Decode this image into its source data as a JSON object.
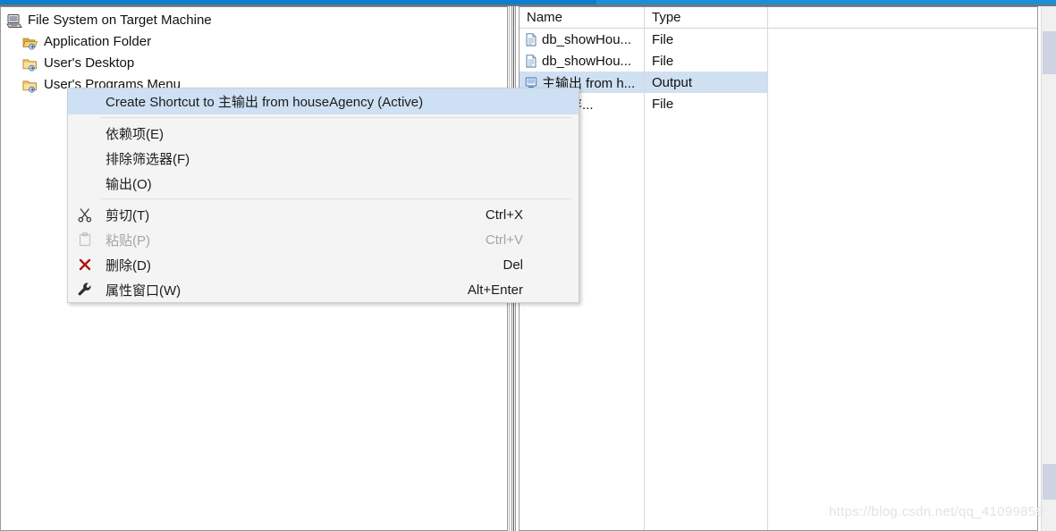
{
  "window": {
    "accent_color": "#0d7fcf",
    "accent_color_light": "#1d8fd6"
  },
  "tree": {
    "items": [
      {
        "label": "File System on Target Machine",
        "icon": "computer-icon",
        "indent": 0
      },
      {
        "label": "Application Folder",
        "icon": "folder-open-shortcut-icon",
        "indent": 1
      },
      {
        "label": "User's Desktop",
        "icon": "folder-shortcut-icon",
        "indent": 1
      },
      {
        "label": "User's Programs Menu",
        "icon": "folder-shortcut-icon",
        "indent": 1
      }
    ]
  },
  "file_list": {
    "columns": [
      "Name",
      "Type"
    ],
    "rows": [
      {
        "name": "db_showHou...",
        "type": "File",
        "icon": "file-icon",
        "selected": false
      },
      {
        "name": "db_showHou...",
        "type": "File",
        "icon": "file-icon",
        "selected": false
      },
      {
        "name": "主输出 from h...",
        "type": "Output",
        "icon": "output-icon",
        "selected": true
      },
      {
        "name": "程的存...",
        "type": "File",
        "icon": "file-icon",
        "selected": false
      }
    ]
  },
  "context_menu": {
    "items": [
      {
        "label": "Create Shortcut to 主输出 from houseAgency (Active)",
        "accel": "",
        "icon": "",
        "highlight": true,
        "disabled": false
      },
      {
        "label": "依赖项(E)",
        "accel": "",
        "icon": "",
        "highlight": false,
        "disabled": false
      },
      {
        "label": "排除筛选器(F)",
        "accel": "",
        "icon": "",
        "highlight": false,
        "disabled": false
      },
      {
        "label": "输出(O)",
        "accel": "",
        "icon": "",
        "highlight": false,
        "disabled": false
      },
      {
        "label": "剪切(T)",
        "accel": "Ctrl+X",
        "icon": "scissors-icon",
        "highlight": false,
        "disabled": false
      },
      {
        "label": "粘贴(P)",
        "accel": "Ctrl+V",
        "icon": "clipboard-paste-icon",
        "highlight": false,
        "disabled": true
      },
      {
        "label": "删除(D)",
        "accel": "Del",
        "icon": "delete-x-icon",
        "highlight": false,
        "disabled": false
      },
      {
        "label": "属性窗口(W)",
        "accel": "Alt+Enter",
        "icon": "wrench-icon",
        "highlight": false,
        "disabled": false
      }
    ],
    "highlight_color": "#cde0f4"
  },
  "watermark": {
    "text": "https://blog.csdn.net/qq_41099859"
  }
}
